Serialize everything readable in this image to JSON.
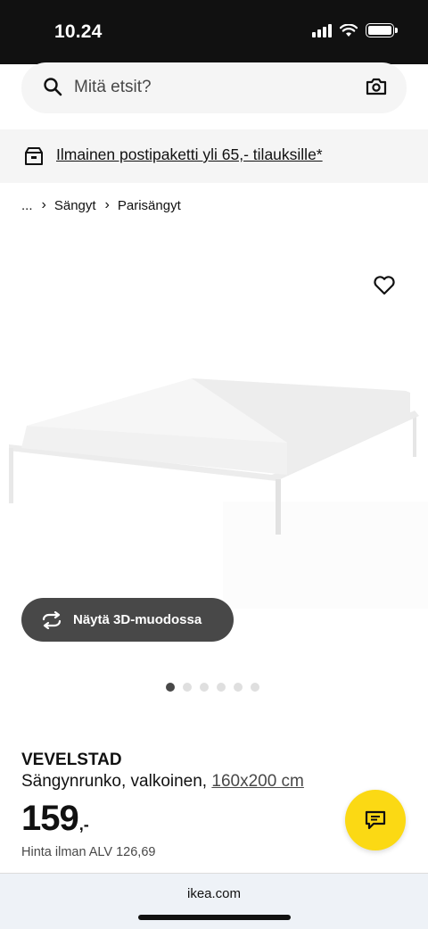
{
  "status_bar": {
    "time": "10.24"
  },
  "search": {
    "placeholder": "Mitä etsit?"
  },
  "promo": {
    "text": "Ilmainen postipaketti yli 65,- tilauksille*"
  },
  "breadcrumb": {
    "items": [
      "...",
      "Sängyt",
      "Parisängyt"
    ],
    "separator": "›"
  },
  "gallery": {
    "button_3d_label": "Näytä 3D-muodossa",
    "image_count": 6,
    "active_index": 0
  },
  "product": {
    "name": "VEVELSTAD",
    "description": "Sängynrunko, valkoinen,",
    "size": "160x200 cm",
    "price": "159",
    "price_suffix": ",-",
    "vat_note": "Hinta ilman ALV 126,69"
  },
  "browser": {
    "url": "ikea.com"
  },
  "colors": {
    "accent_yellow": "#fbd914",
    "dark_grey": "#484848",
    "light_grey": "#f5f5f5"
  },
  "icons": [
    "search-icon",
    "camera-icon",
    "delivery-box-icon",
    "heart-icon",
    "rotate-3d-icon",
    "chat-icon"
  ]
}
